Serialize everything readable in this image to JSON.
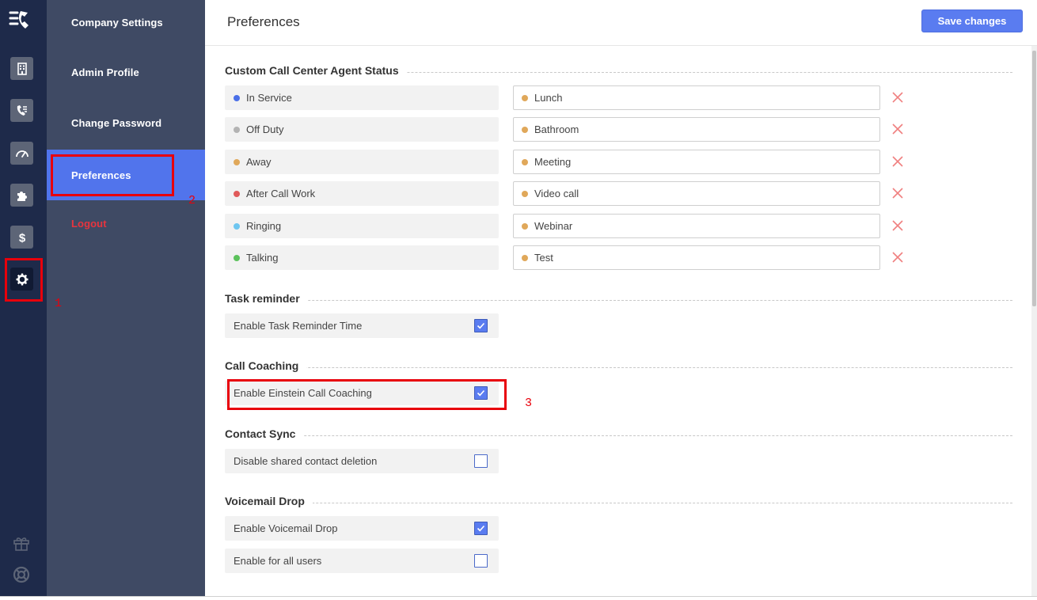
{
  "header": {
    "title": "Preferences",
    "save_label": "Save changes"
  },
  "nav_rail": {
    "items": [
      {
        "icon": "building-icon"
      },
      {
        "icon": "call-list-icon"
      },
      {
        "icon": "speedometer-icon"
      },
      {
        "icon": "puzzle-icon"
      },
      {
        "icon": "dollar-icon"
      },
      {
        "icon": "gear-icon",
        "active": true
      }
    ],
    "bottom": [
      {
        "icon": "gift-icon"
      },
      {
        "icon": "lifebuoy-icon"
      }
    ]
  },
  "settings_menu": {
    "items": [
      {
        "label": "Company Settings"
      },
      {
        "label": "Admin Profile"
      },
      {
        "label": "Change Password"
      },
      {
        "label": "Preferences",
        "active": true
      },
      {
        "label": "Logout"
      }
    ]
  },
  "agent_status": {
    "title": "Custom Call Center Agent Status",
    "default_statuses": [
      {
        "label": "In Service",
        "color": "#4a6fe8"
      },
      {
        "label": "Off Duty",
        "color": "#b3b3b3"
      },
      {
        "label": "Away",
        "color": "#e0a85a"
      },
      {
        "label": "After Call Work",
        "color": "#e05a5a"
      },
      {
        "label": "Ringing",
        "color": "#6ec6f0"
      },
      {
        "label": "Talking",
        "color": "#5cc25c"
      }
    ],
    "custom_statuses": [
      {
        "label": "Lunch",
        "color": "#e0a85a"
      },
      {
        "label": "Bathroom",
        "color": "#e0a85a"
      },
      {
        "label": "Meeting",
        "color": "#e0a85a"
      },
      {
        "label": "Video call",
        "color": "#e0a85a"
      },
      {
        "label": "Webinar",
        "color": "#e0a85a"
      },
      {
        "label": "Test",
        "color": "#e0a85a"
      }
    ]
  },
  "task_reminder": {
    "title": "Task reminder",
    "options": [
      {
        "label": "Enable Task Reminder Time",
        "checked": true
      }
    ]
  },
  "call_coaching": {
    "title": "Call Coaching",
    "options": [
      {
        "label": "Enable Einstein Call Coaching",
        "checked": true
      }
    ]
  },
  "contact_sync": {
    "title": "Contact Sync",
    "options": [
      {
        "label": "Disable shared contact deletion",
        "checked": false
      }
    ]
  },
  "voicemail_drop": {
    "title": "Voicemail Drop",
    "options": [
      {
        "label": "Enable Voicemail Drop",
        "checked": true
      },
      {
        "label": "Enable for all users",
        "checked": false
      }
    ]
  },
  "annotations": [
    "1",
    "2",
    "3"
  ],
  "colors": {
    "rail_bg": "#1e2a4a",
    "menu_bg": "#3f4a64",
    "accent": "#5174ec",
    "logout": "#e8343e",
    "annotation": "#e8000b",
    "delete": "#f08080"
  }
}
